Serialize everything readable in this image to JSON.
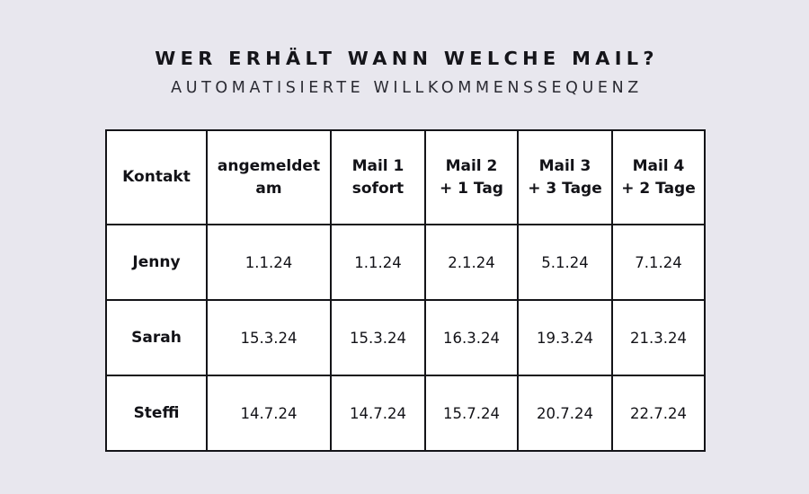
{
  "heading": {
    "title": "WER ERHÄLT WANN WELCHE MAIL?",
    "subtitle": "AUTOMATISIERTE WILLKOMMENSSEQUENZ"
  },
  "colors": {
    "background": "#e8e7ee",
    "ink": "#141418",
    "cell_background": "#ffffff"
  },
  "table": {
    "columns": [
      {
        "line1": "Kontakt",
        "line2": ""
      },
      {
        "line1": "angemeldet",
        "line2": "am"
      },
      {
        "line1": "Mail 1",
        "line2": "sofort"
      },
      {
        "line1": "Mail 2",
        "line2": "+ 1 Tag"
      },
      {
        "line1": "Mail 3",
        "line2": "+ 3 Tage"
      },
      {
        "line1": "Mail 4",
        "line2": "+ 2 Tage"
      }
    ],
    "rows": [
      {
        "name": "Jenny",
        "cells": [
          "1.1.24",
          "1.1.24",
          "2.1.24",
          "5.1.24",
          "7.1.24"
        ]
      },
      {
        "name": "Sarah",
        "cells": [
          "15.3.24",
          "15.3.24",
          "16.3.24",
          "19.3.24",
          "21.3.24"
        ]
      },
      {
        "name": "Steffi",
        "cells": [
          "14.7.24",
          "14.7.24",
          "15.7.24",
          "20.7.24",
          "22.7.24"
        ]
      }
    ]
  }
}
